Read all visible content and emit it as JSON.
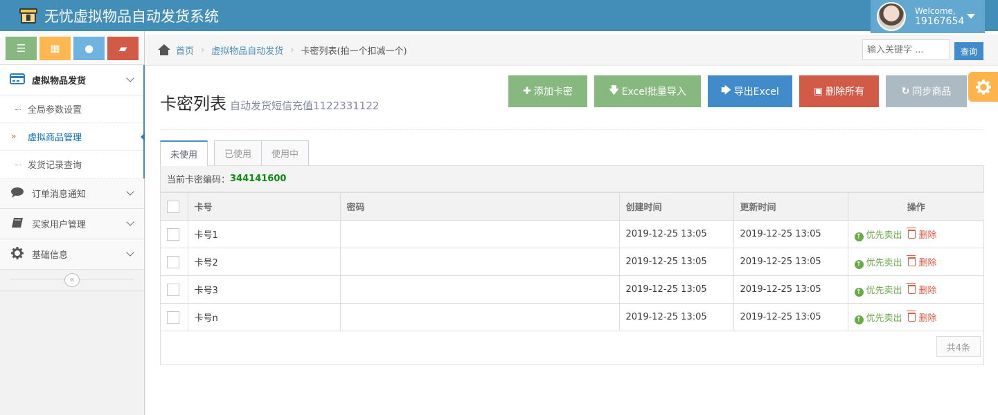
{
  "app": {
    "title": "无忧虚拟物品自动发货系统"
  },
  "user": {
    "welcome": "Welcome,",
    "name": "19167654"
  },
  "shortcuts": [
    {
      "icon": "list-icon",
      "glyph": "☰"
    },
    {
      "icon": "calendar-icon",
      "glyph": "▦"
    },
    {
      "icon": "comment-icon",
      "glyph": "●"
    },
    {
      "icon": "book-icon",
      "glyph": "▰"
    }
  ],
  "sidebar": {
    "items": [
      {
        "label": "虚拟物品发货",
        "icon": "credit-card-icon"
      },
      {
        "label": "订单消息通知",
        "icon": "comment-icon"
      },
      {
        "label": "买家用户管理",
        "icon": "book-icon"
      },
      {
        "label": "基础信息",
        "icon": "gear-icon"
      }
    ],
    "submenu": [
      {
        "label": "全局参数设置"
      },
      {
        "label": "虚拟商品管理"
      },
      {
        "label": "发货记录查询"
      }
    ]
  },
  "breadcrumb": {
    "home": "首页",
    "section": "虚拟物品自动发货",
    "current": "卡密列表(拍一个扣减一个)"
  },
  "search": {
    "placeholder": "输入关键字 ...",
    "button": "查询"
  },
  "page": {
    "title": "卡密列表",
    "subtitle": "自动发货短信充值1122331122"
  },
  "toolbar": {
    "add": "添加卡密",
    "import": "Excel批量导入",
    "export": "导出Excel",
    "delete_all": "删除所有",
    "sync": "同步商品"
  },
  "tabs": [
    "未使用",
    "已使用",
    "使用中"
  ],
  "current_code": {
    "label": "当前卡密编码：",
    "value": "344141600"
  },
  "table": {
    "headers": [
      "卡号",
      "密码",
      "创建时间",
      "更新时间",
      "操作"
    ],
    "rows": [
      {
        "card": "卡号1",
        "password": "",
        "created": "2019-12-25 13:05",
        "updated": "2019-12-25 13:05"
      },
      {
        "card": "卡号2",
        "password": "",
        "created": "2019-12-25 13:05",
        "updated": "2019-12-25 13:05"
      },
      {
        "card": "卡号3",
        "password": "",
        "created": "2019-12-25 13:05",
        "updated": "2019-12-25 13:05"
      },
      {
        "card": "卡号n",
        "password": "",
        "created": "2019-12-25 13:05",
        "updated": "2019-12-25 13:05"
      }
    ],
    "action_priority": "优先卖出",
    "action_delete": "删除"
  },
  "pagination": {
    "total": "共4条"
  },
  "colors": {
    "navbar": "#438eb9",
    "green": "#87b87f",
    "blue": "#428bca",
    "red": "#d15b47",
    "grey": "#abbac3",
    "orange": "#ffb44b"
  }
}
